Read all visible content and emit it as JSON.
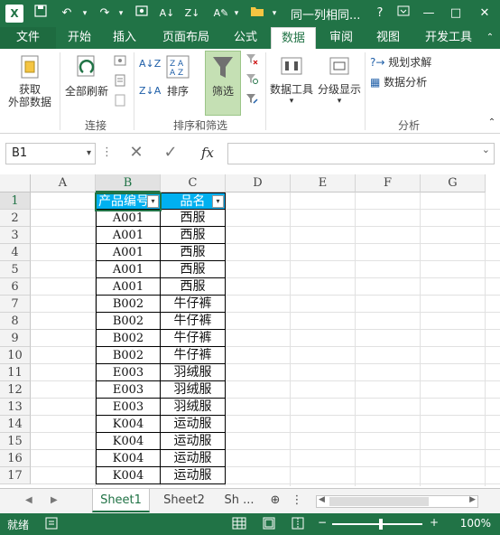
{
  "titlebar": {
    "app_icon": "X≣",
    "title": "同一列相同...",
    "help": "?",
    "ribbon_display_icon": "ribbon-display-icon",
    "minimize": "—",
    "restore": "□",
    "close": "✕"
  },
  "ribbon_tabs": [
    "文件",
    "开始",
    "插入",
    "页面布局",
    "公式",
    "数据",
    "审阅",
    "视图",
    "开发工具"
  ],
  "active_tab": "数据",
  "ribbon": {
    "get_external_data": "获取\n外部数据",
    "refresh_all": "全部刷新",
    "connections_group": "连接",
    "sort": "排序",
    "filter": "筛选",
    "sort_filter_group": "排序和筛选",
    "data_tools": "数据工具",
    "outline": "分级显示",
    "solver": "规划求解",
    "data_analysis": "数据分析",
    "analysis_group": "分析"
  },
  "formula_bar": {
    "name_box": "B1",
    "fx": "fx",
    "formula": ""
  },
  "columns": [
    "A",
    "B",
    "C",
    "D",
    "E",
    "F",
    "G"
  ],
  "rows": [
    "1",
    "2",
    "3",
    "4",
    "5",
    "6",
    "7",
    "8",
    "9",
    "10",
    "11",
    "12",
    "13",
    "14",
    "15",
    "16",
    "17"
  ],
  "table": {
    "headers": [
      "产品编号",
      "品名"
    ],
    "data": [
      [
        "A001",
        "西服"
      ],
      [
        "A001",
        "西服"
      ],
      [
        "A001",
        "西服"
      ],
      [
        "A001",
        "西服"
      ],
      [
        "A001",
        "西服"
      ],
      [
        "B002",
        "牛仔裤"
      ],
      [
        "B002",
        "牛仔裤"
      ],
      [
        "B002",
        "牛仔裤"
      ],
      [
        "B002",
        "牛仔裤"
      ],
      [
        "E003",
        "羽绒服"
      ],
      [
        "E003",
        "羽绒服"
      ],
      [
        "E003",
        "羽绒服"
      ],
      [
        "K004",
        "运动服"
      ],
      [
        "K004",
        "运动服"
      ],
      [
        "K004",
        "运动服"
      ],
      [
        "K004",
        "运动服"
      ]
    ]
  },
  "sheets": [
    "Sheet1",
    "Sheet2",
    "Sh ..."
  ],
  "active_sheet": "Sheet1",
  "status": {
    "ready": "就绪",
    "zoom": "100%"
  },
  "colors": {
    "accent": "#217346",
    "header_fill": "#00b0f0"
  }
}
